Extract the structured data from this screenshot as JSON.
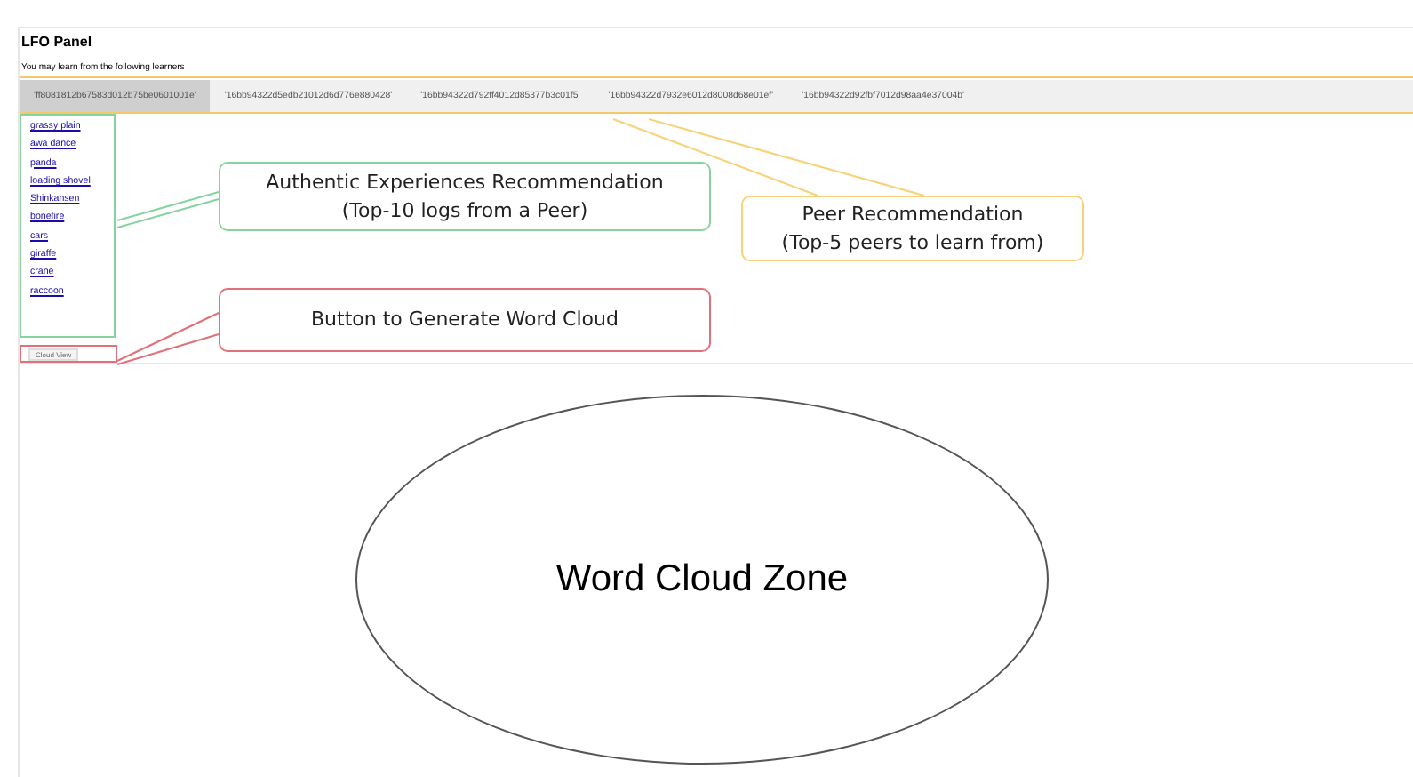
{
  "panel": {
    "title": "LFO Panel",
    "subtitle": "You may learn from the following learners"
  },
  "peer_tabs": [
    {
      "label": "'ff8081812b67583d012b75be0601001e'",
      "selected": true
    },
    {
      "label": "'16bb94322d5edb21012d6d776e880428'",
      "selected": false
    },
    {
      "label": "'16bb94322d792ff4012d85377b3c01f5'",
      "selected": false
    },
    {
      "label": "'16bb94322d7932e6012d8008d68e01ef'",
      "selected": false
    },
    {
      "label": "'16bb94322d92fbf7012d98aa4e37004b'",
      "selected": false
    }
  ],
  "log_links": [
    "grassy plain",
    "awa dance",
    "panda",
    "loading shovel",
    "Shinkansen",
    "bonefire",
    "cars",
    "giraffe",
    "crane",
    "raccoon"
  ],
  "cloud_button": {
    "label": "Cloud View"
  },
  "word_cloud_zone": {
    "label": "Word Cloud Zone"
  },
  "annotations": [
    {
      "kind": "logs",
      "text": "Authentic Experiences Recommendation",
      "subtext": "(Top-10 logs from a Peer)",
      "color": "#86d39f"
    },
    {
      "kind": "peers",
      "text": "Peer Recommendation",
      "subtext": "(Top-5 peers to learn from)",
      "color": "#f7d27a"
    },
    {
      "kind": "button",
      "text": "Button to Generate Word Cloud",
      "color": "#e0707a"
    }
  ]
}
